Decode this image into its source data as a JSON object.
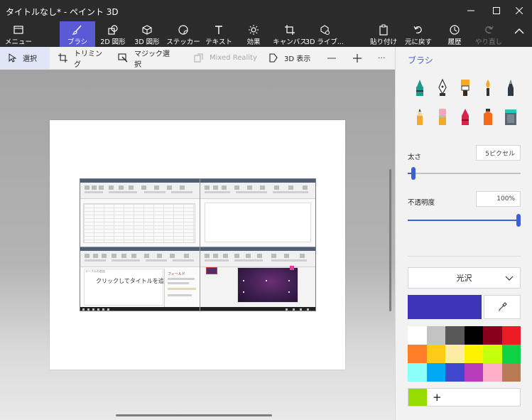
{
  "window": {
    "title": "タイトルなし* - ペイント 3D",
    "minimize": "—",
    "maximize": "☐",
    "close": "✕"
  },
  "ribbon": {
    "menu": "メニュー",
    "brushes": "ブラシ",
    "shapes2d": "2D 図形",
    "shapes3d": "3D 図形",
    "stickers": "ステッカー",
    "text": "テキスト",
    "effects": "効果",
    "canvas": "キャンバス",
    "library3d": "3D ライブ...",
    "paste": "貼り付け",
    "undo": "元に戻す",
    "history": "履歴",
    "redo": "やり直し",
    "expand": "^"
  },
  "toolbar": {
    "select": "選択",
    "crop": "トリミング",
    "magic_select": "マジック選択",
    "mixed_reality": "Mixed Reality",
    "view3d": "3D 表示",
    "zoom_out": "—",
    "zoom_in": "+",
    "more": "···"
  },
  "canvas": {
    "embedded_title": "クリックしてタイトルを追加",
    "embedded_small": "テーブルの追加",
    "embedded_pane_title": "フィールド"
  },
  "panel": {
    "title": "ブラシ",
    "tools": [
      "marker-icon",
      "calligraphy-pen-icon",
      "oil-brush-icon",
      "watercolor-icon",
      "pixel-pen-icon",
      "pencil-icon",
      "eraser-icon",
      "crayon-icon",
      "spray-can-icon",
      "fill-bucket-icon"
    ],
    "thickness_label": "太さ",
    "thickness_value": "5ピクセル",
    "thickness_fraction": 0.03,
    "opacity_label": "不透明度",
    "opacity_value": "100%",
    "opacity_fraction": 1.0,
    "finish": "光沢",
    "current_color": "#3d34b8",
    "custom_add": "+",
    "custom_color": "#96dc00"
  },
  "palette": [
    "#ffffff",
    "#c3c3c3",
    "#585858",
    "#000000",
    "#88001b",
    "#ec1c24",
    "#ff7f27",
    "#ffca18",
    "#fdeca6",
    "#fff200",
    "#c4ff0e",
    "#0ed145",
    "#8cfffb",
    "#00a8f3",
    "#3f48cc",
    "#b83dba",
    "#ffaec8",
    "#b97a56"
  ],
  "colors": {
    "accent": "#5a5ad6",
    "panel_title": "#4b5bd9",
    "slider": "#3c5fd6"
  }
}
